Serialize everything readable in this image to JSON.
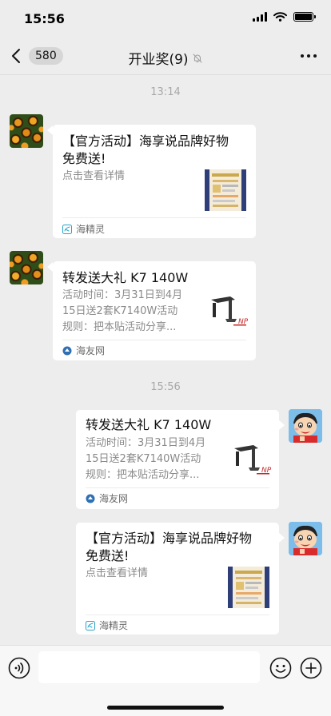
{
  "status_bar": {
    "time": "15:56"
  },
  "nav": {
    "unread_count": "580",
    "title": "开业奖(9)"
  },
  "chat": {
    "messages": [
      {
        "time": "13:14",
        "title_line1": "【官方活动】海享说品牌好物",
        "title_line2": "免费送!",
        "desc_line1": "点击查看详情",
        "source": "海精灵"
      },
      {
        "title_line1": "转发送大礼 K7 140W",
        "desc_line1": "活动时间：3月31日到4月",
        "desc_line2": "15日送2套K7140W活动",
        "desc_line3": "规则：把本贴活动分享...",
        "source": "海友网"
      },
      {
        "time": "15:56",
        "title_line1": "转发送大礼 K7 140W",
        "desc_line1": "活动时间：3月31日到4月",
        "desc_line2": "15日送2套K7140W活动",
        "desc_line3": "规则：把本贴活动分享...",
        "source": "海友网"
      },
      {
        "title_line1": "【官方活动】海享说品牌好物",
        "title_line2": "免费送!",
        "desc_line1": "点击查看详情",
        "source": "海精灵"
      }
    ]
  },
  "input_bar": {
    "value": "",
    "placeholder": ""
  },
  "icons": {
    "back": "chevron-left-icon",
    "mute": "mute-bell-icon",
    "more": "ellipsis-icon",
    "voice": "voice-icon",
    "emoji": "emoji-icon",
    "add": "plus-circle-icon"
  },
  "colors": {
    "background": "#ededed",
    "card": "#ffffff",
    "source_teal": "#2ba3c8",
    "source_blue": "#2f6fb4"
  }
}
